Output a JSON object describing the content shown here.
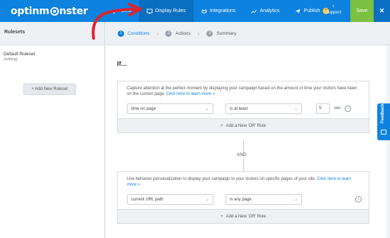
{
  "header": {
    "logo_text_a": "optinm",
    "logo_text_b": "nster",
    "nav": [
      {
        "label": "Desi",
        "icon": "brush-icon"
      },
      {
        "label": "Display Rules",
        "icon": "monitor-icon"
      },
      {
        "label": "Integrations",
        "icon": "plug-icon"
      },
      {
        "label": "Analytics",
        "icon": "chart-icon"
      },
      {
        "label": "Publish",
        "icon": "send-icon",
        "badge": "!"
      }
    ],
    "support_label": "Support",
    "support_icon": "?",
    "save_label": "Save",
    "close_label": "✕"
  },
  "sidebar": {
    "title": "Rulesets",
    "rulesets": [
      {
        "name": "Default Ruleset",
        "status": "(editing)"
      }
    ],
    "add_label": "+ Add New Ruleset"
  },
  "steps": [
    {
      "num": "1",
      "label": "Conditions"
    },
    {
      "num": "2",
      "label": "Actions"
    },
    {
      "num": "3",
      "label": "Summary"
    }
  ],
  "main": {
    "if_title": "If...",
    "and_label": "AND",
    "rules": [
      {
        "description": "Capture attention at the perfect moment by displaying your campaign based on the amount of time your visitors have been on the current page.",
        "link": "Click here to learn more »",
        "field": "time on page",
        "operator": "is at least",
        "value": "5",
        "unit": "sec.",
        "add_or_label": "Add a New 'OR' Rule"
      },
      {
        "description": "Use behavior personalization to display your campaign to your visitors on specific pages of your site.",
        "link": "Click here to learn more »",
        "field": "current URL path",
        "operator": "is any page",
        "add_or_label": "Add a New 'OR' Rule"
      }
    ]
  },
  "feedback_label": "Feedback",
  "colors": {
    "primary": "#0d82df",
    "active_nav": "#0a6fc0",
    "save": "#7cc142",
    "annotation": "#e0232b"
  }
}
